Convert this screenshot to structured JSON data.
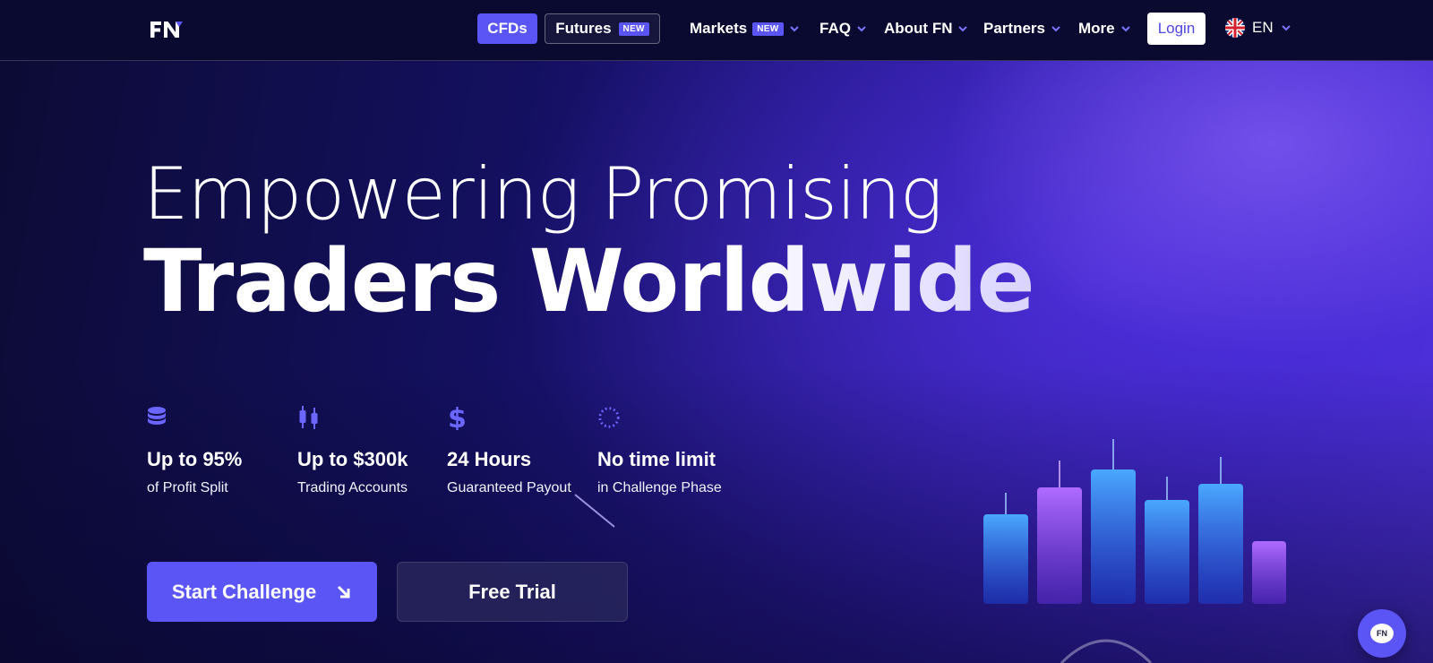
{
  "header": {
    "logo_text": "FN",
    "tabs": [
      {
        "label": "CFDs",
        "active": true
      },
      {
        "label": "Futures",
        "badge": "NEW",
        "active": false
      }
    ],
    "nav": [
      {
        "label": "Markets",
        "badge": "NEW",
        "has_dropdown": true
      },
      {
        "label": "FAQ",
        "has_dropdown": true
      },
      {
        "label": "About FN",
        "has_dropdown": true
      },
      {
        "label": "Partners",
        "has_dropdown": true
      },
      {
        "label": "More",
        "has_dropdown": true
      }
    ],
    "login_label": "Login",
    "language": {
      "code": "EN",
      "flag_icon": "uk-flag-icon"
    }
  },
  "hero": {
    "headline_line1": "Empowering Promising",
    "headline_line2": "Traders Worldwide",
    "stats": [
      {
        "icon": "coin-stack-icon",
        "value": "Up to 95%",
        "label": "of Profit Split"
      },
      {
        "icon": "candlestick-icon",
        "value": "Up to $300k",
        "label": "Trading Accounts"
      },
      {
        "icon": "dollar-icon",
        "value": "24 Hours",
        "label": "Guaranteed Payout"
      },
      {
        "icon": "dotted-circle-icon",
        "value": "No time limit",
        "label": "in Challenge Phase"
      }
    ],
    "primary_cta": {
      "label": "Start Challenge",
      "icon": "arrow-down-right-icon"
    },
    "secondary_cta": {
      "label": "Free Trial"
    }
  },
  "chat_widget": {
    "label": "FN",
    "icon": "chat-bubble-icon"
  },
  "colors": {
    "accent": "#5b55f5",
    "background": "#0b0a2e",
    "login_text": "#4f46e5"
  }
}
